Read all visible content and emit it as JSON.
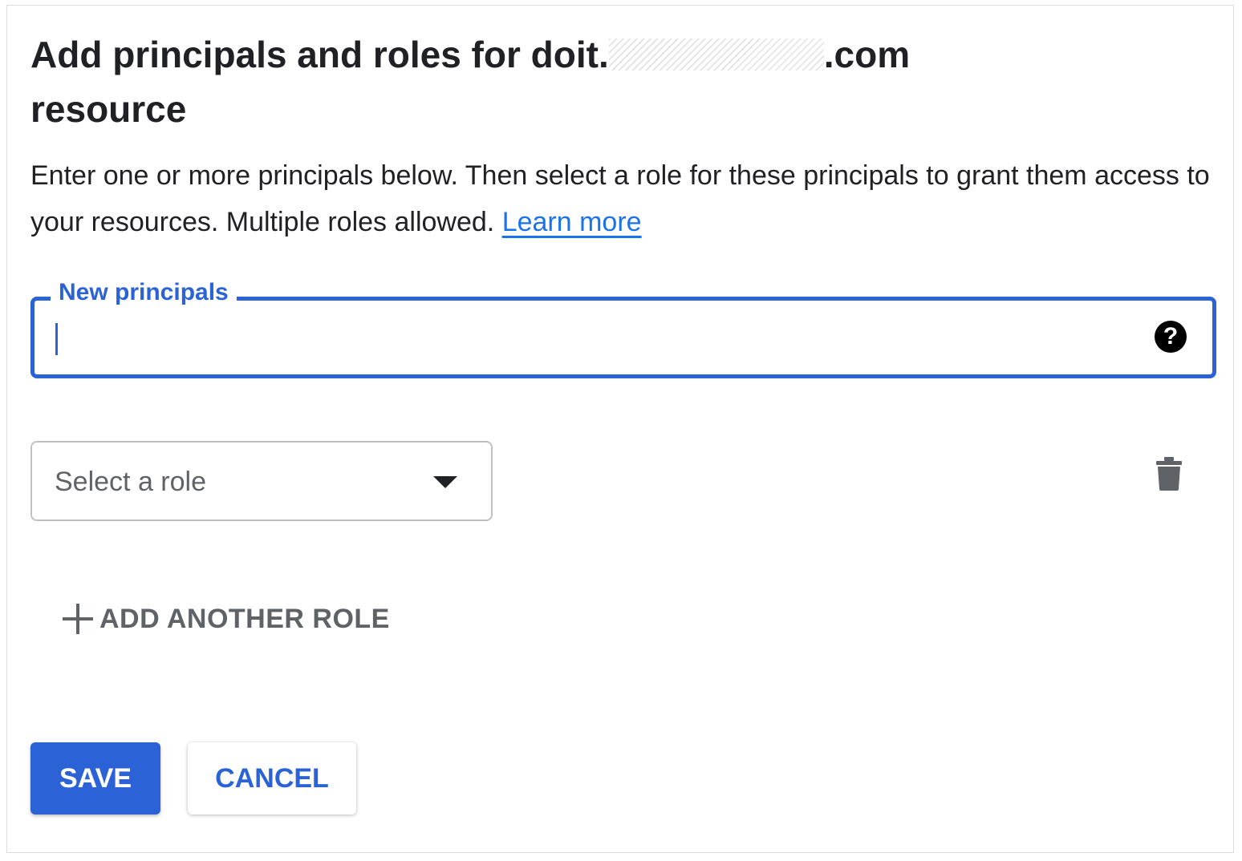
{
  "dialog": {
    "title_prefix": "Add principals and roles for doit.",
    "title_redacted": "redacted-domain",
    "title_suffix": ".com",
    "title_line2": "resource",
    "description": "Enter one or more principals below. Then select a role for these principals to grant them access to your resources. Multiple roles allowed.",
    "learn_more_label": "Learn more"
  },
  "principals_field": {
    "label": "New principals",
    "value": "",
    "help_icon": "help-circle-icon",
    "help_glyph": "?"
  },
  "role": {
    "placeholder": "Select a role",
    "dropdown_icon": "arrow-drop-down-icon",
    "delete_icon": "trash-icon"
  },
  "add_role": {
    "label": "ADD ANOTHER ROLE",
    "icon": "plus-icon"
  },
  "actions": {
    "save_label": "SAVE",
    "cancel_label": "CANCEL"
  },
  "colors": {
    "primary": "#2b63d6",
    "link": "#1a73e8",
    "text": "#202124",
    "muted": "#5f6368",
    "border": "#bdc1c6"
  }
}
